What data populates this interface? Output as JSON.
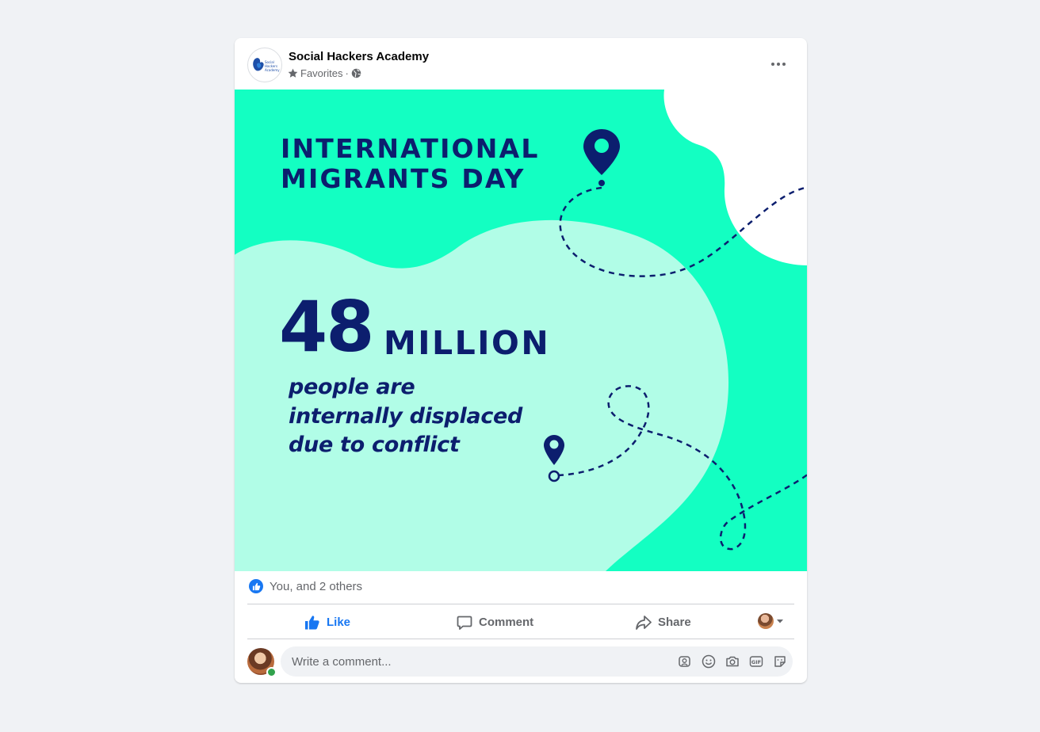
{
  "post": {
    "page_name": "Social Hackers Academy",
    "favorites_label": "Favorites",
    "separator": "·",
    "logo_text": "Social Hackers Academy",
    "more_icon": "more-horizontal-icon"
  },
  "image": {
    "headline_line1": "INTERNATIONAL",
    "headline_line2": "MIGRANTS DAY",
    "big_number": "48",
    "unit": "MILLION",
    "description": "people are internally displaced due to conflict",
    "colors": {
      "mint": "#13ffc2",
      "light_mint": "#b1fde7",
      "navy": "#0c1e6e",
      "white": "#ffffff"
    }
  },
  "reactions": {
    "icon": "like-reaction-icon",
    "text": "You, and 2 others"
  },
  "actions": {
    "like": "Like",
    "comment": "Comment",
    "share": "Share"
  },
  "comment": {
    "placeholder": "Write a comment..."
  },
  "accent": "#1877f2"
}
